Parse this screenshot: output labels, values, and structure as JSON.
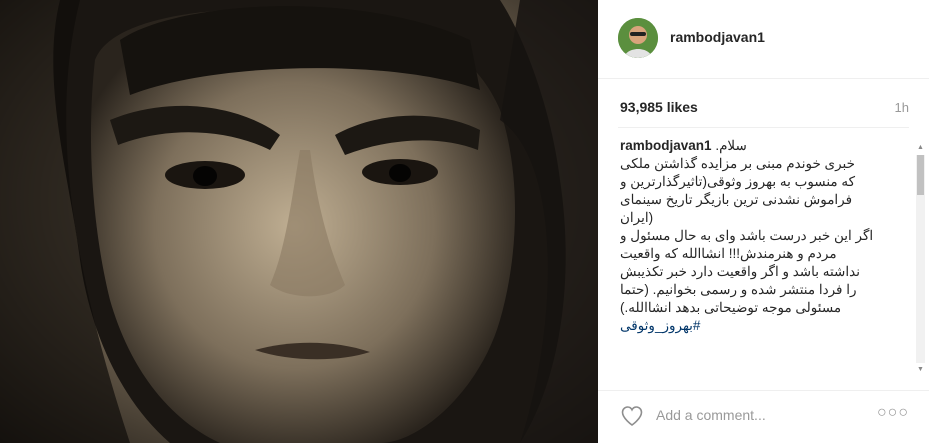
{
  "post": {
    "username": "rambodjavan1",
    "likes": "93,985 likes",
    "time": "1h",
    "caption_user": "rambodjavan1",
    "caption_lines": ".سلام",
    "caption_body": "خبری خوندم مبنی بر مزایده گذاشتن ملکی\nکه منسوب به بهروز وثوقی(تاثیرگذارترین و\nفراموش نشدنی ترین بازیگر تاریخ سینمای\n(ایران\nاگر این خبر درست باشد وای به حال مسئول و\nمردم و هنرمندش!!! انشاالله که واقعیت\nنداشته باشد و اگر واقعیت دارد خبر تکذیبش\nرا فردا منتشر شده و رسمی بخوانیم. (حتما\nمسئولی موجه توضیحاتی بدهد انشاالله.)",
    "hashtag": "#بهروز_وثوقی",
    "comment_placeholder": "Add a comment..."
  },
  "icons": {
    "like": "heart-icon",
    "more": "more-options-icon",
    "avatar": "avatar"
  },
  "colors": {
    "hashtag": "#003569",
    "muted": "#999999",
    "text": "#262626"
  }
}
